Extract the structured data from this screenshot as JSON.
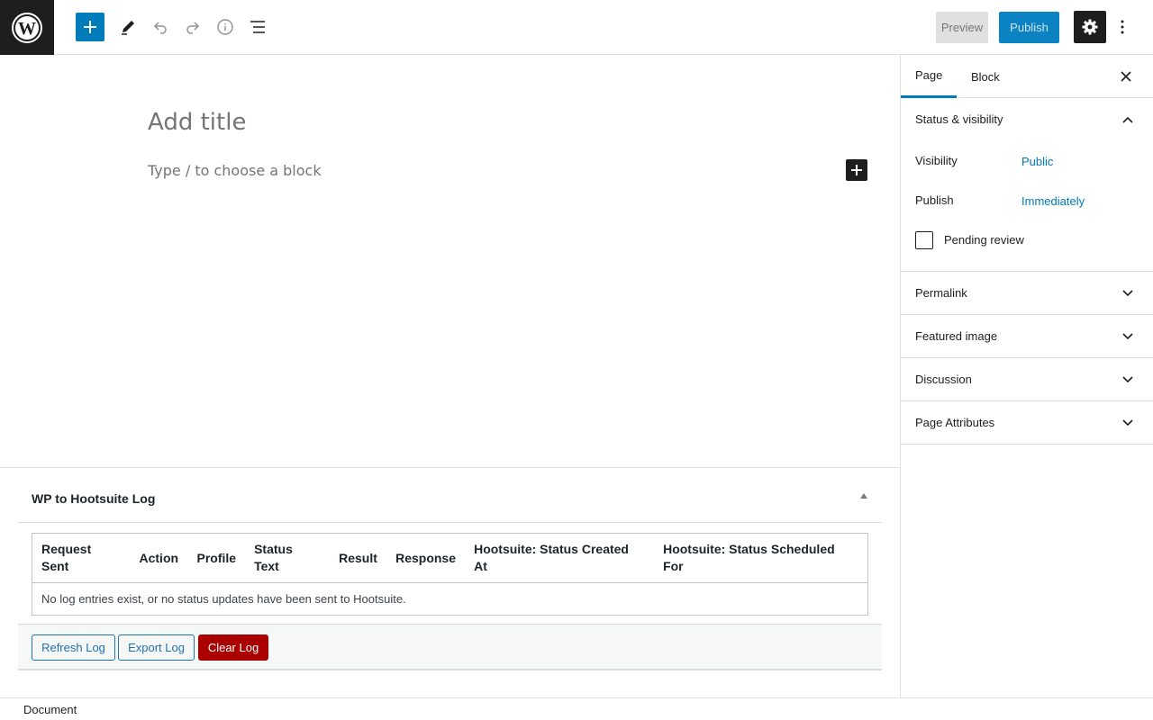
{
  "header": {
    "preview_label": "Preview",
    "publish_label": "Publish"
  },
  "editor": {
    "title_placeholder": "Add title",
    "block_placeholder": "Type / to choose a block"
  },
  "metabox": {
    "title": "WP to Hootsuite Log",
    "columns": [
      "Request Sent",
      "Action",
      "Profile",
      "Status Text",
      "Result",
      "Response",
      "Hootsuite: Status Created At",
      "Hootsuite: Status Scheduled For"
    ],
    "empty_message": "No log entries exist, or no status updates have been sent to Hootsuite.",
    "buttons": {
      "refresh": "Refresh Log",
      "export": "Export Log",
      "clear": "Clear Log"
    }
  },
  "footer": {
    "breadcrumb": "Document"
  },
  "sidebar": {
    "tabs": [
      {
        "label": "Page"
      },
      {
        "label": "Block"
      }
    ],
    "status_panel": {
      "title": "Status & visibility",
      "visibility_label": "Visibility",
      "visibility_value": "Public",
      "publish_label": "Publish",
      "publish_value": "Immediately",
      "pending_label": "Pending review"
    },
    "panels": [
      {
        "title": "Permalink"
      },
      {
        "title": "Featured image"
      },
      {
        "title": "Discussion"
      },
      {
        "title": "Page Attributes"
      }
    ]
  },
  "colors": {
    "accent": "#007cba",
    "danger": "#aa0000",
    "dark": "#1e1e1e"
  }
}
